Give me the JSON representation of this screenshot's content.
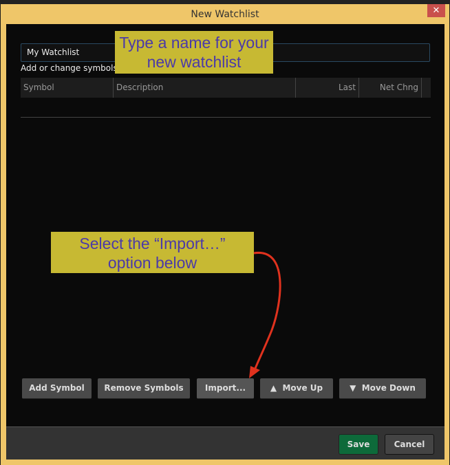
{
  "window": {
    "title": "New Watchlist",
    "close_icon": "close-icon"
  },
  "name_input": {
    "value": "My Watchlist"
  },
  "hint": "Add or change symbols directly in the table below",
  "table": {
    "columns": [
      "Symbol",
      "Description",
      "Last",
      "Net Chng"
    ]
  },
  "buttons": {
    "add": "Add Symbol",
    "remove": "Remove Symbols",
    "import": "Import...",
    "move_up": "Move Up",
    "move_down": "Move Down",
    "up_glyph": "▲",
    "down_glyph": "▼"
  },
  "footer": {
    "save": "Save",
    "cancel": "Cancel"
  },
  "annotations": {
    "callout1": "Type a name for your new watchlist",
    "callout2": "Select the “Import…” option below",
    "arrow_color": "#e0321e"
  }
}
